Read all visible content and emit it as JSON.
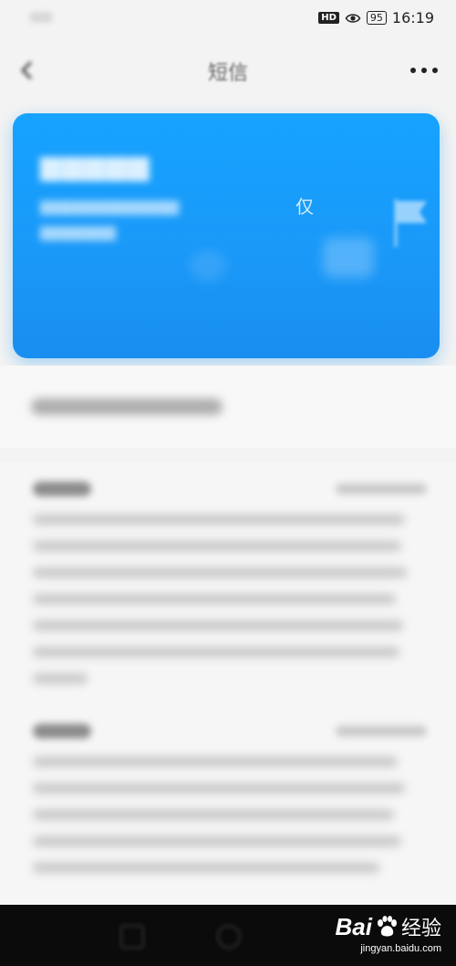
{
  "status_bar": {
    "hd_badge": "HD",
    "battery": "95",
    "time": "16:19",
    "icons": [
      "hd-icon",
      "eye-icon",
      "battery-icon"
    ]
  },
  "header": {
    "title": "短信",
    "icons": [
      "back-icon",
      "more-icon"
    ]
  },
  "banner": {
    "subtitle_end": "仅",
    "icons": [
      "flag-icon"
    ],
    "color": "#16a3ff"
  },
  "watermark": {
    "brand": "Bai",
    "brand_cn": "经验",
    "url": "jingyan.baidu.com",
    "icons": [
      "baidu-paw-icon"
    ]
  }
}
